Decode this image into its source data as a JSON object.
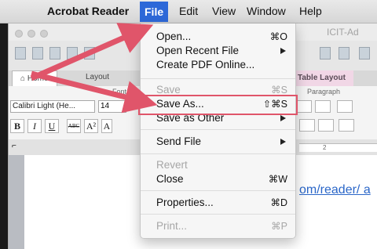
{
  "menubar": {
    "apple": "",
    "app_name": "Acrobat Reader",
    "items": [
      "File",
      "Edit",
      "View",
      "Window",
      "Help"
    ]
  },
  "window": {
    "title": "ICIT-Ad",
    "ribbon_tabs": [
      "Home",
      "Layout",
      "Table Layout"
    ],
    "font_group_label": "Font",
    "paragraph_group_label": "Paragraph",
    "font_name": "Calibri Light (He...",
    "font_size": "14",
    "format_buttons": [
      "B",
      "I",
      "U",
      "ABC",
      "A²",
      "A"
    ],
    "ruler_mark": "2",
    "doc_text": "om/reader/ a"
  },
  "file_menu": {
    "items": [
      {
        "label": "Open...",
        "shortcut": "⌘O",
        "enabled": true,
        "submenu": false
      },
      {
        "label": "Open Recent File",
        "shortcut": "",
        "enabled": true,
        "submenu": true
      },
      {
        "label": "Create PDF Online...",
        "shortcut": "",
        "enabled": true,
        "submenu": false
      },
      {
        "label": "Save",
        "shortcut": "⌘S",
        "enabled": false,
        "submenu": false
      },
      {
        "label": "Save As...",
        "shortcut": "⇧⌘S",
        "enabled": true,
        "submenu": false
      },
      {
        "label": "Save as Other",
        "shortcut": "",
        "enabled": true,
        "submenu": true
      },
      {
        "label": "Send File",
        "shortcut": "",
        "enabled": true,
        "submenu": true
      },
      {
        "label": "Revert",
        "shortcut": "",
        "enabled": false,
        "submenu": false
      },
      {
        "label": "Close",
        "shortcut": "⌘W",
        "enabled": true,
        "submenu": false
      },
      {
        "label": "Properties...",
        "shortcut": "⌘D",
        "enabled": true,
        "submenu": false
      },
      {
        "label": "Print...",
        "shortcut": "⌘P",
        "enabled": false,
        "submenu": false
      }
    ]
  },
  "colors": {
    "menu_highlight": "#2d68d8",
    "annotation_red": "#e0556a",
    "link_blue": "#2a66c8",
    "table_tab": "#f1d7e6"
  }
}
